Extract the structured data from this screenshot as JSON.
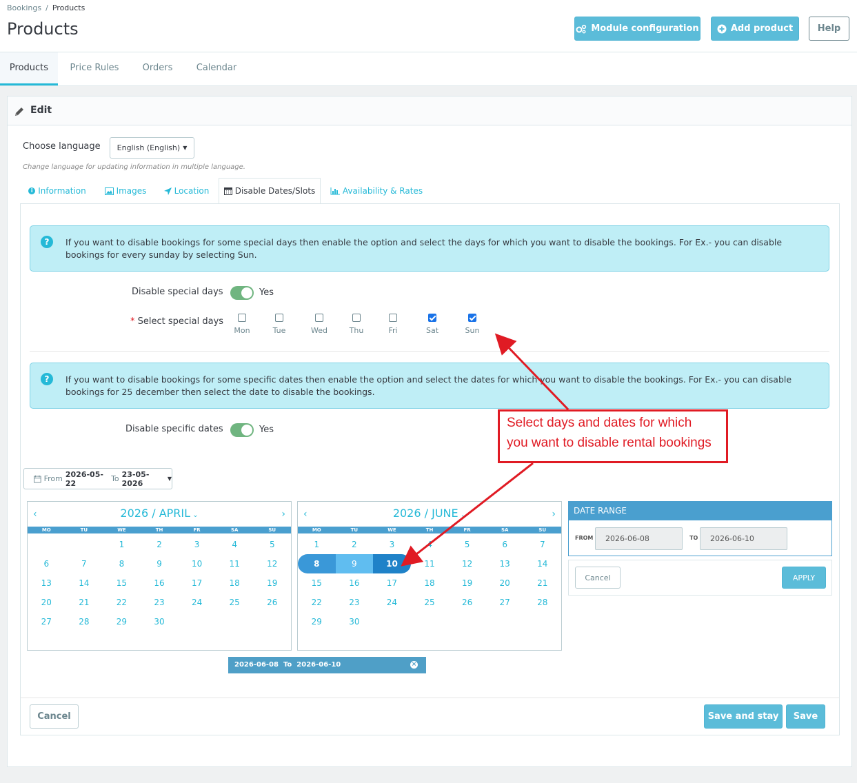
{
  "breadcrumb": {
    "parent": "Bookings",
    "separator": "/",
    "current": "Products"
  },
  "page": {
    "title": "Products"
  },
  "header_buttons": {
    "module_config": "Module configuration",
    "add_product": "Add product",
    "help": "Help"
  },
  "main_tabs": [
    {
      "label": "Products",
      "active": true
    },
    {
      "label": "Price Rules",
      "active": false
    },
    {
      "label": "Orders",
      "active": false
    },
    {
      "label": "Calendar",
      "active": false
    }
  ],
  "panel": {
    "title": "Edit"
  },
  "language": {
    "label": "Choose language",
    "selected": "English (English)",
    "help": "Change language for updating information in multiple language."
  },
  "form_tabs": [
    {
      "label": "Information",
      "icon": "info-icon",
      "active": false
    },
    {
      "label": "Images",
      "icon": "image-icon",
      "active": false
    },
    {
      "label": "Location",
      "icon": "location-arrow-icon",
      "active": false
    },
    {
      "label": "Disable Dates/Slots",
      "icon": "calendar-icon",
      "active": true
    },
    {
      "label": "Availability & Rates",
      "icon": "bar-chart-icon",
      "active": false
    }
  ],
  "alerts": {
    "special_days": "If you want to disable bookings for some special days then enable the option and select the days for which you want to disable the bookings. For Ex.- you can disable bookings for every sunday by selecting Sun.",
    "specific_dates": "If you want to disable bookings for some specific dates then enable the option and select the dates for which you want to disable the bookings. For Ex.- you can disable bookings for 25 december then select the date to disable the bookings."
  },
  "disable_special_days": {
    "label": "Disable special days",
    "value": "Yes",
    "enabled": true
  },
  "select_special_days": {
    "label": "Select special days",
    "required_mark": "*",
    "days": [
      {
        "label": "Mon",
        "checked": false
      },
      {
        "label": "Tue",
        "checked": false
      },
      {
        "label": "Wed",
        "checked": false
      },
      {
        "label": "Thu",
        "checked": false
      },
      {
        "label": "Fri",
        "checked": false
      },
      {
        "label": "Sat",
        "checked": true
      },
      {
        "label": "Sun",
        "checked": true
      }
    ]
  },
  "disable_specific_dates": {
    "label": "Disable specific dates",
    "value": "Yes",
    "enabled": true
  },
  "range_button": {
    "from_label": "From",
    "from": "2026-05-22",
    "to_label": "To",
    "to": "23-05-2026"
  },
  "weekdays": [
    "MO",
    "TU",
    "WE",
    "TH",
    "FR",
    "SA",
    "SU"
  ],
  "calendars": [
    {
      "title": "2026 / APRIL",
      "prev": "‹",
      "next": "›",
      "rows": [
        [
          "",
          "",
          "1",
          "2",
          "3",
          "4",
          "5"
        ],
        [
          "6",
          "7",
          "8",
          "9",
          "10",
          "11",
          "12"
        ],
        [
          "13",
          "14",
          "15",
          "16",
          "17",
          "18",
          "19"
        ],
        [
          "20",
          "21",
          "22",
          "23",
          "24",
          "25",
          "26"
        ],
        [
          "27",
          "28",
          "29",
          "30",
          "",
          "",
          ""
        ]
      ]
    },
    {
      "title": "2026 / JUNE",
      "prev": "‹",
      "next": "›",
      "rows": [
        [
          "1",
          "2",
          "3",
          "4",
          "5",
          "6",
          "7"
        ],
        [
          "8",
          "9",
          "10",
          "11",
          "12",
          "13",
          "14"
        ],
        [
          "15",
          "16",
          "17",
          "18",
          "19",
          "20",
          "21"
        ],
        [
          "22",
          "23",
          "24",
          "25",
          "26",
          "27",
          "28"
        ],
        [
          "29",
          "30",
          "",
          "",
          "",
          "",
          ""
        ]
      ],
      "selected": [
        "8",
        "9",
        "10"
      ]
    }
  ],
  "date_range": {
    "header": "DATE RANGE",
    "from_label": "FROM",
    "from_value": "2026-06-08",
    "to_label": "TO",
    "to_value": "2026-06-10",
    "cancel": "Cancel",
    "apply": "APPLY"
  },
  "selected_range": {
    "from": "2026-06-08",
    "to_label": "To",
    "to": "2026-06-10",
    "remove": "×"
  },
  "footer": {
    "cancel": "Cancel",
    "save_and_stay": "Save and stay",
    "save": "Save"
  },
  "annotation": {
    "line1": "Select days and dates for which",
    "line2": "you want to disable rental bookings"
  },
  "colors": {
    "accent": "#25b9d7",
    "button": "#5bbcd9",
    "switch_on": "#70b580",
    "annotation": "#e01b24",
    "range_header": "#4a9fcf"
  }
}
